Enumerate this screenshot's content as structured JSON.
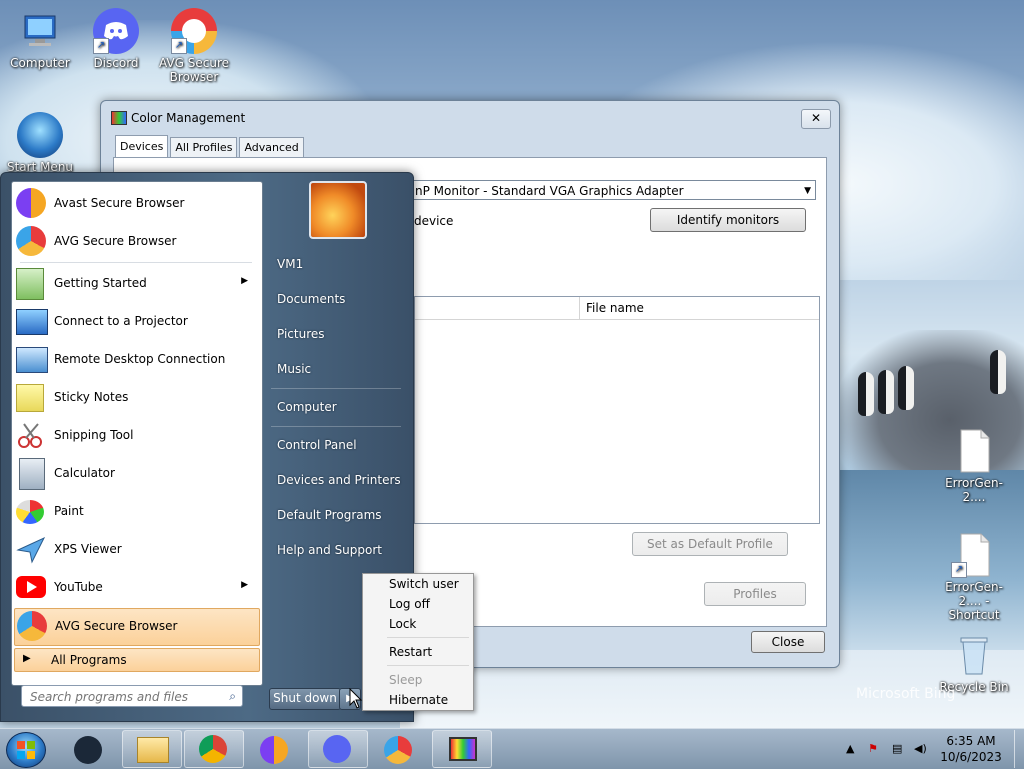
{
  "desktop": {
    "icons": [
      {
        "label": "Computer"
      },
      {
        "label": "Discord"
      },
      {
        "label": "AVG Secure Browser"
      },
      {
        "label": "Start Menu 8"
      },
      {
        "label": "ErrorGen-2...."
      },
      {
        "label": "ErrorGen-2.... - Shortcut"
      },
      {
        "label": "Recycle Bin"
      }
    ],
    "watermark": "Microsoft Bing"
  },
  "color_management": {
    "title": "Color Management",
    "tabs": [
      "Devices",
      "All Profiles",
      "Advanced"
    ],
    "device_value": "nP Monitor - Standard VGA Graphics Adapter",
    "use_settings_label": "device",
    "identify_label": "Identify monitors",
    "column_file": "File name",
    "set_default_label": "Set as Default Profile",
    "profiles_label": "Profiles",
    "close_label": "Close"
  },
  "start_menu": {
    "programs": [
      {
        "label": "Avast Secure Browser",
        "submenu": false
      },
      {
        "label": "AVG Secure Browser",
        "submenu": false
      },
      {
        "label": "Getting Started",
        "submenu": true
      },
      {
        "label": "Connect to a Projector",
        "submenu": false
      },
      {
        "label": "Remote Desktop Connection",
        "submenu": false
      },
      {
        "label": "Sticky Notes",
        "submenu": false
      },
      {
        "label": "Snipping Tool",
        "submenu": false
      },
      {
        "label": "Calculator",
        "submenu": false
      },
      {
        "label": "Paint",
        "submenu": false
      },
      {
        "label": "XPS Viewer",
        "submenu": false
      },
      {
        "label": "YouTube",
        "submenu": true
      },
      {
        "label": "AVG Secure Browser",
        "submenu": false
      }
    ],
    "all_programs": "All Programs",
    "search_placeholder": "Search programs and files",
    "right": [
      "VM1",
      "Documents",
      "Pictures",
      "Music",
      "Computer",
      "Control Panel",
      "Devices and Printers",
      "Default Programs",
      "Help and Support"
    ],
    "shutdown_label": "Shut down"
  },
  "power_menu": {
    "items": [
      "Switch user",
      "Log off",
      "Lock",
      "Restart",
      "Sleep",
      "Hibernate"
    ]
  },
  "taskbar": {
    "time": "6:35 AM",
    "date": "10/6/2023"
  },
  "colors": {
    "highlight": "#fbd19a",
    "window_frame": "#cfdcea"
  }
}
